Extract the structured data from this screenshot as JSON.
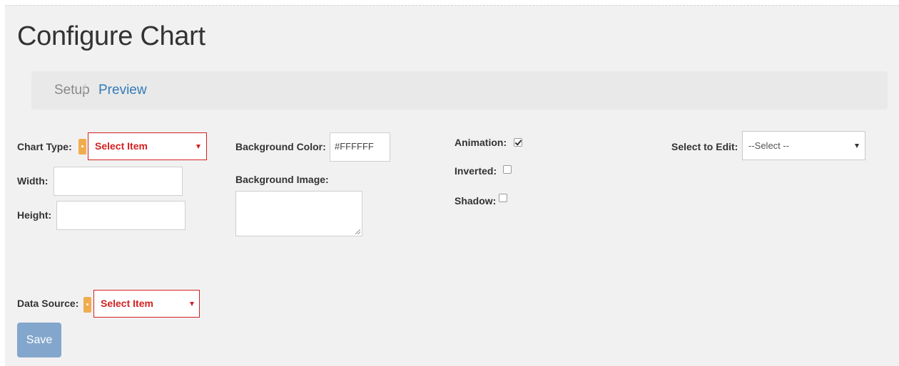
{
  "page": {
    "title": "Configure Chart"
  },
  "breadcrumb": {
    "items": [
      "Setup",
      "Preview"
    ],
    "separator": "/"
  },
  "form": {
    "chart_type": {
      "label": "Chart Type:",
      "value": "Select Item"
    },
    "width": {
      "label": "Width:",
      "value": ""
    },
    "height": {
      "label": "Height:",
      "value": ""
    },
    "background_color": {
      "label": "Background Color:",
      "value": "#FFFFFF"
    },
    "background_image": {
      "label": "Background Image:",
      "value": ""
    },
    "animation": {
      "label": "Animation:",
      "checked": true
    },
    "inverted": {
      "label": "Inverted:",
      "checked": false
    },
    "shadow": {
      "label": "Shadow:",
      "checked": false
    },
    "select_to_edit": {
      "label": "Select to Edit:",
      "value": "--Select --"
    },
    "data_source": {
      "label": "Data Source:",
      "value": "Select Item"
    }
  },
  "actions": {
    "save_label": "Save"
  },
  "colors": {
    "accent": "#337ab7",
    "error": "#d42020",
    "badge": "#f0ad4e",
    "button": "#83a7cc"
  }
}
